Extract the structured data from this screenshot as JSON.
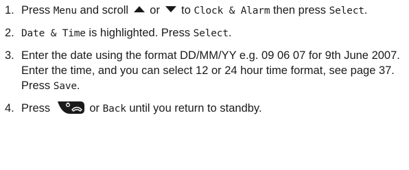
{
  "steps": [
    {
      "number": "1.",
      "t1": "Press ",
      "k1": "Menu",
      "t2": " and scroll ",
      "up_icon": "up-arrow-icon",
      "t3": " or ",
      "down_icon": "down-arrow-icon",
      "t4": " to ",
      "k2": "Clock & Alarm",
      "t5": " then press ",
      "k3": "Select",
      "t6": "."
    },
    {
      "number": "2.",
      "k1": "Date & Time",
      "t1": " is highlighted. Press ",
      "k2": "Select",
      "t2": "."
    },
    {
      "number": "3.",
      "t1": "Enter the date using the format DD/MM/YY e.g. 09 06 07 for 9th June 2007. Enter the time, and you can select 12 or 24 hour time format, see page 37. Press ",
      "k1": "Save",
      "t2": "."
    },
    {
      "number": "4.",
      "t1": "Press ",
      "key_icon": "end-call-key-icon",
      "t2": " or ",
      "k1": "Back",
      "t3": " until you return to standby."
    }
  ],
  "colors": {
    "text": "#1a1a1a",
    "key_fill": "#1a1a1a",
    "key_glyph": "#ffffff"
  }
}
